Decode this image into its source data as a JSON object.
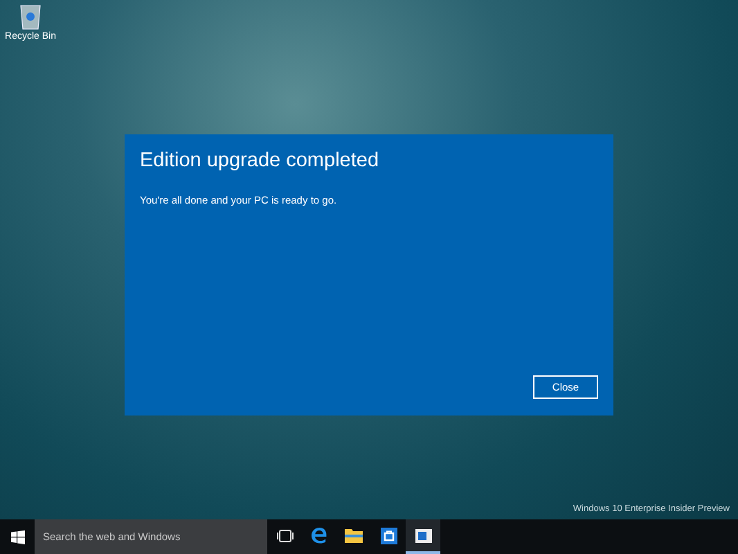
{
  "desktop": {
    "icons": [
      {
        "label": "Recycle Bin"
      }
    ],
    "edition_text": "Windows 10 Enterprise Insider Preview"
  },
  "dialog": {
    "title": "Edition upgrade completed",
    "message": "You're all done and your PC is ready to go.",
    "buttons": [
      "Close"
    ]
  },
  "taskbar": {
    "search": {
      "placeholder": "Search the web and Windows"
    },
    "apps": [
      {
        "kind": "task-view",
        "active": false
      },
      {
        "kind": "browser",
        "active": false
      },
      {
        "kind": "folder",
        "active": false
      },
      {
        "kind": "store",
        "active": false
      },
      {
        "kind": "window",
        "active": true
      }
    ]
  }
}
